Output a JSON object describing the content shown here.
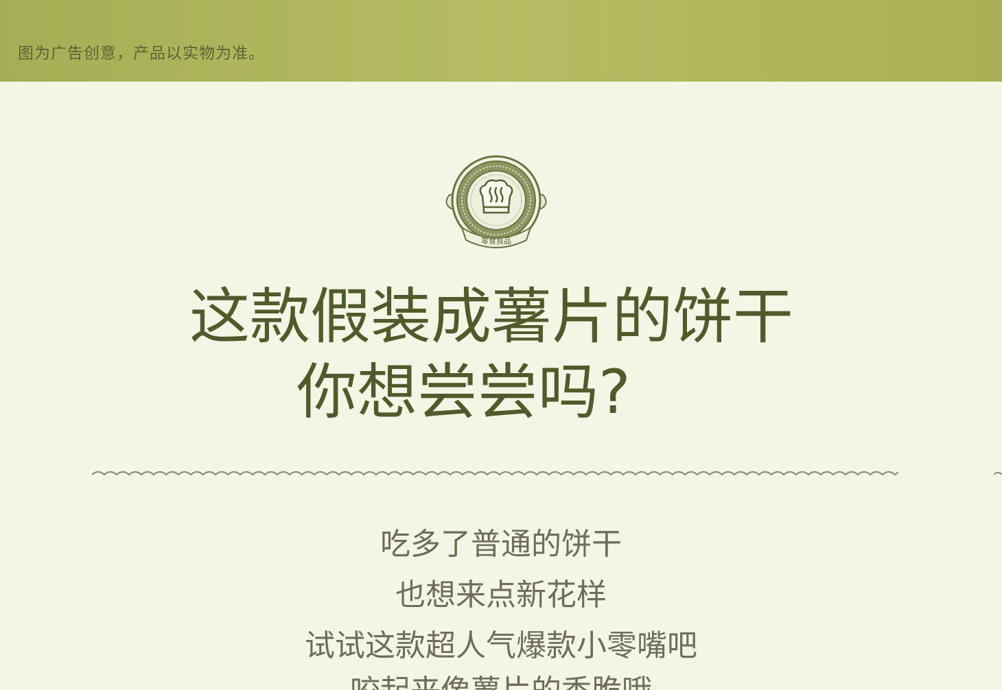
{
  "banner": {
    "disclaimer": "图为广告创意，产品以实物为准。"
  },
  "emblem": {
    "icon": "chef-hat-icon",
    "caption": "零食良品"
  },
  "headline": {
    "line1": "这款假装成薯片的饼干",
    "line2": "你想尝尝吗?"
  },
  "body": {
    "lines": [
      "吃多了普通的饼干",
      "也想来点新花样",
      "试试这款超人气爆款小零嘴吧",
      "咬起来像薯片的香脆哦"
    ]
  },
  "colors": {
    "band": "#b0b75c",
    "background": "#f5f5e6",
    "headline": "#505a2a",
    "body_text": "#6d6d5a"
  }
}
